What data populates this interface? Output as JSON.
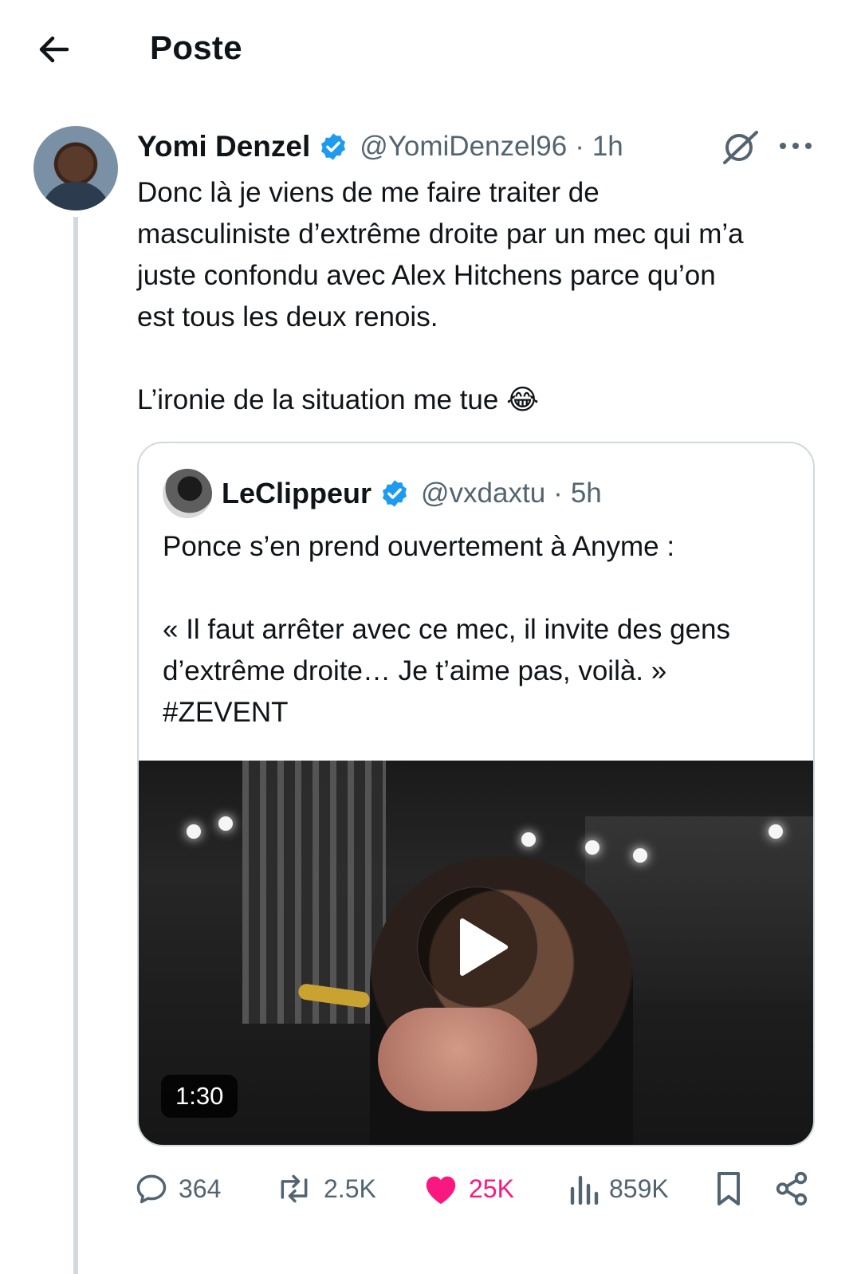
{
  "header": {
    "title": "Poste"
  },
  "tweet": {
    "author_name": "Yomi Denzel",
    "handle": "@YomiDenzel96",
    "separator": "·",
    "time": "1h",
    "text": "Donc là je viens de me faire traiter de\nmasculiniste d’extrême droite par un mec qui m’a\njuste confondu avec Alex Hitchens parce qu’on\nest tous les deux renois.\n\nL’ironie de la situation me tue 😂"
  },
  "quote": {
    "author_name": "LeClippeur",
    "handle": "@vxdaxtu",
    "separator": "·",
    "time": "5h",
    "text": "Ponce s’en prend ouvertement à Anyme :\n\n« Il faut arrêter avec ce mec, il invite des gens\nd’extrême droite… Je t’aime pas, voilà. »\n#ZEVENT",
    "video_duration": "1:30"
  },
  "actions": {
    "replies": "364",
    "reposts": "2.5K",
    "likes": "25K",
    "views": "859K"
  },
  "colors": {
    "verified": "#1d9bf0",
    "like": "#f91880",
    "secondary_text": "#536471",
    "border": "#cfd9de"
  },
  "icons": [
    "back-arrow-icon",
    "verified-badge-icon",
    "grok-icon",
    "more-icon",
    "play-icon",
    "reply-icon",
    "repost-icon",
    "heart-icon",
    "views-icon",
    "bookmark-icon",
    "share-icon"
  ]
}
